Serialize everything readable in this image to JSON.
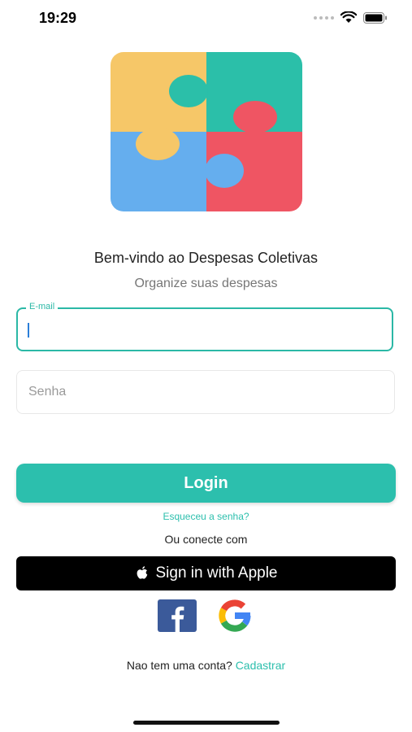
{
  "status_bar": {
    "time": "19:29"
  },
  "header": {
    "welcome": "Bem-vindo ao Despesas Coletivas",
    "subtitle": "Organize suas despesas"
  },
  "form": {
    "email_label": "E-mail",
    "email_value": "",
    "password_placeholder": "Senha",
    "login_label": "Login",
    "forgot_label": "Esqueceu a senha?"
  },
  "social": {
    "divider_label": "Ou conecte com",
    "apple_label": "Sign in with Apple",
    "facebook_icon": "facebook-icon",
    "google_icon": "google-icon"
  },
  "footer": {
    "no_account": "Nao tem uma conta?",
    "signup_label": "Cadastrar"
  },
  "colors": {
    "accent": "#2cbfad",
    "puzzle_yellow": "#f6c768",
    "puzzle_teal": "#2bbfa9",
    "puzzle_blue": "#65aeee",
    "puzzle_red": "#ef5563"
  }
}
